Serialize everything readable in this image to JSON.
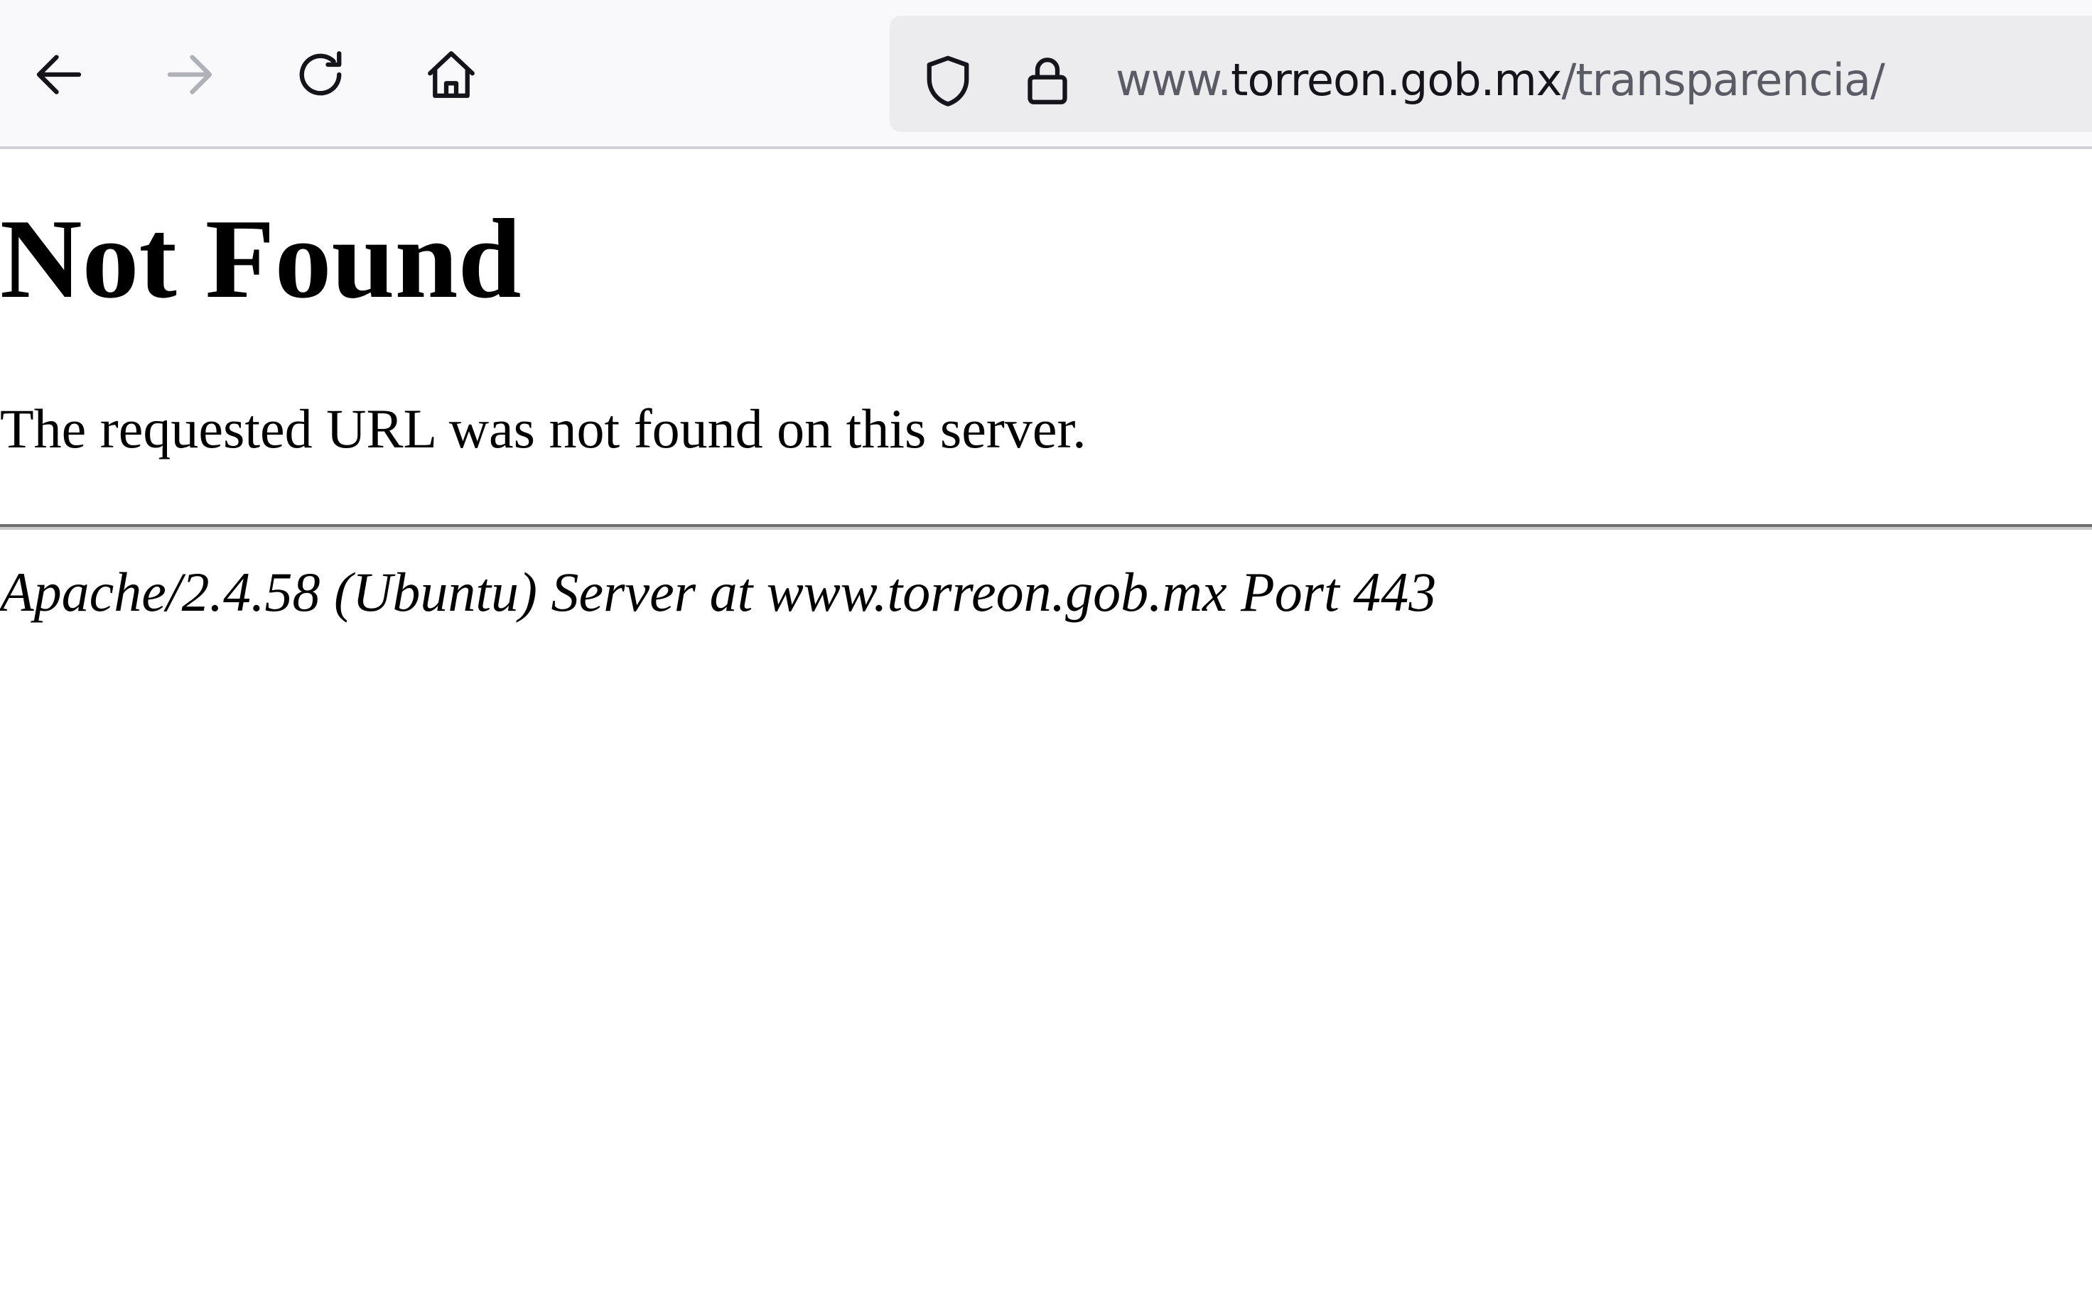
{
  "browser": {
    "icons": {
      "back": "back-arrow-icon",
      "forward": "forward-arrow-icon",
      "reload": "reload-icon",
      "home": "home-icon",
      "tracking_protection": "shield-icon",
      "security": "lock-icon"
    },
    "url": {
      "prefix": "www.",
      "host": "torreon.gob.mx",
      "path": "/transparencia/"
    },
    "colors": {
      "toolbar_bg": "#f9f9fb",
      "urlbar_bg": "#ececef",
      "icon_active": "#15141a",
      "icon_disabled": "#b0b0b8"
    }
  },
  "page": {
    "title": "Not Found",
    "message": "The requested URL was not found on this server.",
    "server_signature": "Apache/2.4.58 (Ubuntu) Server at www.torreon.gob.mx Port 443"
  }
}
